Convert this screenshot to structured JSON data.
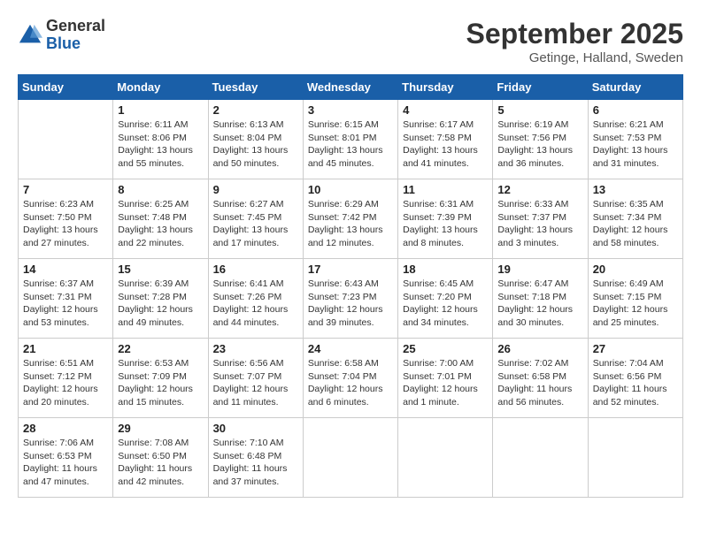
{
  "header": {
    "logo_line1": "General",
    "logo_line2": "Blue",
    "month": "September 2025",
    "location": "Getinge, Halland, Sweden"
  },
  "weekdays": [
    "Sunday",
    "Monday",
    "Tuesday",
    "Wednesday",
    "Thursday",
    "Friday",
    "Saturday"
  ],
  "weeks": [
    [
      {
        "day": "",
        "sunrise": "",
        "sunset": "",
        "daylight": ""
      },
      {
        "day": "1",
        "sunrise": "Sunrise: 6:11 AM",
        "sunset": "Sunset: 8:06 PM",
        "daylight": "Daylight: 13 hours and 55 minutes."
      },
      {
        "day": "2",
        "sunrise": "Sunrise: 6:13 AM",
        "sunset": "Sunset: 8:04 PM",
        "daylight": "Daylight: 13 hours and 50 minutes."
      },
      {
        "day": "3",
        "sunrise": "Sunrise: 6:15 AM",
        "sunset": "Sunset: 8:01 PM",
        "daylight": "Daylight: 13 hours and 45 minutes."
      },
      {
        "day": "4",
        "sunrise": "Sunrise: 6:17 AM",
        "sunset": "Sunset: 7:58 PM",
        "daylight": "Daylight: 13 hours and 41 minutes."
      },
      {
        "day": "5",
        "sunrise": "Sunrise: 6:19 AM",
        "sunset": "Sunset: 7:56 PM",
        "daylight": "Daylight: 13 hours and 36 minutes."
      },
      {
        "day": "6",
        "sunrise": "Sunrise: 6:21 AM",
        "sunset": "Sunset: 7:53 PM",
        "daylight": "Daylight: 13 hours and 31 minutes."
      }
    ],
    [
      {
        "day": "7",
        "sunrise": "Sunrise: 6:23 AM",
        "sunset": "Sunset: 7:50 PM",
        "daylight": "Daylight: 13 hours and 27 minutes."
      },
      {
        "day": "8",
        "sunrise": "Sunrise: 6:25 AM",
        "sunset": "Sunset: 7:48 PM",
        "daylight": "Daylight: 13 hours and 22 minutes."
      },
      {
        "day": "9",
        "sunrise": "Sunrise: 6:27 AM",
        "sunset": "Sunset: 7:45 PM",
        "daylight": "Daylight: 13 hours and 17 minutes."
      },
      {
        "day": "10",
        "sunrise": "Sunrise: 6:29 AM",
        "sunset": "Sunset: 7:42 PM",
        "daylight": "Daylight: 13 hours and 12 minutes."
      },
      {
        "day": "11",
        "sunrise": "Sunrise: 6:31 AM",
        "sunset": "Sunset: 7:39 PM",
        "daylight": "Daylight: 13 hours and 8 minutes."
      },
      {
        "day": "12",
        "sunrise": "Sunrise: 6:33 AM",
        "sunset": "Sunset: 7:37 PM",
        "daylight": "Daylight: 13 hours and 3 minutes."
      },
      {
        "day": "13",
        "sunrise": "Sunrise: 6:35 AM",
        "sunset": "Sunset: 7:34 PM",
        "daylight": "Daylight: 12 hours and 58 minutes."
      }
    ],
    [
      {
        "day": "14",
        "sunrise": "Sunrise: 6:37 AM",
        "sunset": "Sunset: 7:31 PM",
        "daylight": "Daylight: 12 hours and 53 minutes."
      },
      {
        "day": "15",
        "sunrise": "Sunrise: 6:39 AM",
        "sunset": "Sunset: 7:28 PM",
        "daylight": "Daylight: 12 hours and 49 minutes."
      },
      {
        "day": "16",
        "sunrise": "Sunrise: 6:41 AM",
        "sunset": "Sunset: 7:26 PM",
        "daylight": "Daylight: 12 hours and 44 minutes."
      },
      {
        "day": "17",
        "sunrise": "Sunrise: 6:43 AM",
        "sunset": "Sunset: 7:23 PM",
        "daylight": "Daylight: 12 hours and 39 minutes."
      },
      {
        "day": "18",
        "sunrise": "Sunrise: 6:45 AM",
        "sunset": "Sunset: 7:20 PM",
        "daylight": "Daylight: 12 hours and 34 minutes."
      },
      {
        "day": "19",
        "sunrise": "Sunrise: 6:47 AM",
        "sunset": "Sunset: 7:18 PM",
        "daylight": "Daylight: 12 hours and 30 minutes."
      },
      {
        "day": "20",
        "sunrise": "Sunrise: 6:49 AM",
        "sunset": "Sunset: 7:15 PM",
        "daylight": "Daylight: 12 hours and 25 minutes."
      }
    ],
    [
      {
        "day": "21",
        "sunrise": "Sunrise: 6:51 AM",
        "sunset": "Sunset: 7:12 PM",
        "daylight": "Daylight: 12 hours and 20 minutes."
      },
      {
        "day": "22",
        "sunrise": "Sunrise: 6:53 AM",
        "sunset": "Sunset: 7:09 PM",
        "daylight": "Daylight: 12 hours and 15 minutes."
      },
      {
        "day": "23",
        "sunrise": "Sunrise: 6:56 AM",
        "sunset": "Sunset: 7:07 PM",
        "daylight": "Daylight: 12 hours and 11 minutes."
      },
      {
        "day": "24",
        "sunrise": "Sunrise: 6:58 AM",
        "sunset": "Sunset: 7:04 PM",
        "daylight": "Daylight: 12 hours and 6 minutes."
      },
      {
        "day": "25",
        "sunrise": "Sunrise: 7:00 AM",
        "sunset": "Sunset: 7:01 PM",
        "daylight": "Daylight: 12 hours and 1 minute."
      },
      {
        "day": "26",
        "sunrise": "Sunrise: 7:02 AM",
        "sunset": "Sunset: 6:58 PM",
        "daylight": "Daylight: 11 hours and 56 minutes."
      },
      {
        "day": "27",
        "sunrise": "Sunrise: 7:04 AM",
        "sunset": "Sunset: 6:56 PM",
        "daylight": "Daylight: 11 hours and 52 minutes."
      }
    ],
    [
      {
        "day": "28",
        "sunrise": "Sunrise: 7:06 AM",
        "sunset": "Sunset: 6:53 PM",
        "daylight": "Daylight: 11 hours and 47 minutes."
      },
      {
        "day": "29",
        "sunrise": "Sunrise: 7:08 AM",
        "sunset": "Sunset: 6:50 PM",
        "daylight": "Daylight: 11 hours and 42 minutes."
      },
      {
        "day": "30",
        "sunrise": "Sunrise: 7:10 AM",
        "sunset": "Sunset: 6:48 PM",
        "daylight": "Daylight: 11 hours and 37 minutes."
      },
      {
        "day": "",
        "sunrise": "",
        "sunset": "",
        "daylight": ""
      },
      {
        "day": "",
        "sunrise": "",
        "sunset": "",
        "daylight": ""
      },
      {
        "day": "",
        "sunrise": "",
        "sunset": "",
        "daylight": ""
      },
      {
        "day": "",
        "sunrise": "",
        "sunset": "",
        "daylight": ""
      }
    ]
  ]
}
